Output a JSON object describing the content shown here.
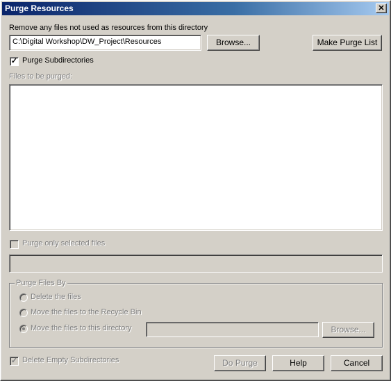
{
  "window": {
    "title": "Purge Resources",
    "close_glyph": "✕"
  },
  "directory": {
    "label": "Remove any files not used as resources from this directory",
    "value": "C:\\Digital Workshop\\DW_Project\\Resources",
    "browse_label": "Browse...",
    "make_list_label": "Make Purge List"
  },
  "subdirs": {
    "label": "Purge Subdirectories",
    "checked_glyph": "✓"
  },
  "files": {
    "label": "Files to be purged:"
  },
  "selected_only": {
    "label": "Purge only selected files"
  },
  "purge_by": {
    "legend": "Purge Files By",
    "options": [
      {
        "label": "Delete the files"
      },
      {
        "label": "Move the files to the Recycle Bin"
      },
      {
        "label": "Move the files to this directory"
      }
    ],
    "browse_label": "Browse..."
  },
  "delete_empty": {
    "label": "Delete Empty Subdirectories",
    "checked_glyph": "✓"
  },
  "buttons": {
    "do_purge": "Do Purge",
    "help": "Help",
    "cancel": "Cancel"
  }
}
